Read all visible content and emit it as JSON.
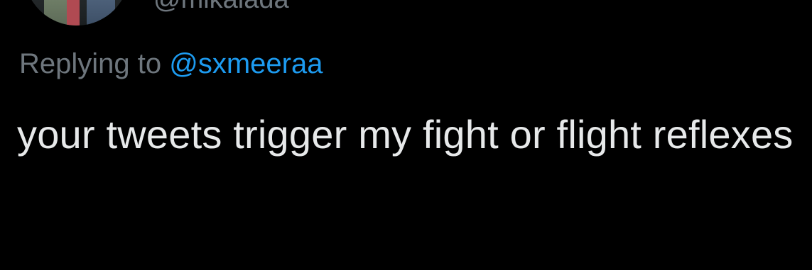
{
  "tweet": {
    "author_handle": "@mikalada",
    "reply_prefix": "Replying to",
    "reply_to_handle": "@sxmeeraa",
    "text": "your tweets trigger my fight or flight reflexes"
  },
  "colors": {
    "background": "#000000",
    "secondary_text": "#6e767d",
    "link": "#1d9bf0",
    "primary_text": "#e7e9ea"
  }
}
